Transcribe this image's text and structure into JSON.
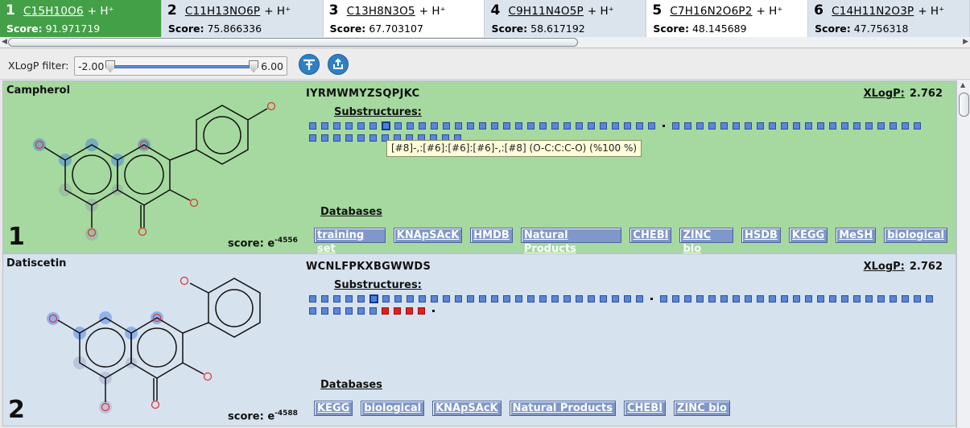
{
  "tabs": [
    {
      "num": "1",
      "formula": "C15H10O6",
      "ion": "+ H⁺",
      "score_label": "Score:",
      "score": "91.971719"
    },
    {
      "num": "2",
      "formula": "C11H13NO6P",
      "ion": "+ H⁺",
      "score_label": "Score:",
      "score": "75.866336"
    },
    {
      "num": "3",
      "formula": "C13H8N3O5",
      "ion": "+ H⁺",
      "score_label": "Score:",
      "score": "67.703107"
    },
    {
      "num": "4",
      "formula": "C9H11N4O5P",
      "ion": "+ H⁺",
      "score_label": "Score:",
      "score": "58.617192"
    },
    {
      "num": "5",
      "formula": "C7H16N2O6P2",
      "ion": "+ H⁺",
      "score_label": "Score:",
      "score": "48.145689"
    },
    {
      "num": "6",
      "formula": "C14H11N2O3P",
      "ion": "+ H⁺",
      "score_label": "Score:",
      "score": "47.756318"
    }
  ],
  "filter": {
    "label": "XLogP filter:",
    "min": "-2.00",
    "max": "6.00"
  },
  "toolbar": {
    "filter_icon": "filter-icon",
    "export_icon": "export-icon"
  },
  "candidates": [
    {
      "name": "Campherol",
      "rank": "1",
      "inchikey": "IYRMWMYZSQPJKC",
      "xlogp_label": "XLogP:",
      "xlogp": "2.762",
      "substructures_label": "Substructures:",
      "databases_label": "Databases",
      "score_prefix": "score: e",
      "score_exp": "-4556",
      "databases": [
        "training set",
        "KNApSAcK",
        "HMDB",
        "Natural Products",
        "CHEBI",
        "ZINC bio",
        "HSDB",
        "KEGG",
        "MeSH",
        "biological"
      ]
    },
    {
      "name": "Datiscetin",
      "rank": "2",
      "inchikey": "WCNLFPKXBGWWDS",
      "xlogp_label": "XLogP:",
      "xlogp": "2.762",
      "substructures_label": "Substructures:",
      "databases_label": "Databases",
      "score_prefix": "score: e",
      "score_exp": "-4588",
      "databases": [
        "KEGG",
        "biological",
        "KNApSAcK",
        "Natural Products",
        "CHEBI",
        "ZINC bio"
      ]
    }
  ],
  "tooltip": "[#8]-,:[#6]:[#6]:[#6]-,:[#8] (O-C:C:C-O)  (%100 %)",
  "colors": {
    "selected_tab": "#43a047",
    "top_candidate": "#a5d99f",
    "other_candidate": "#d6e2ee",
    "fingerprint": "#5a86d8",
    "fingerprint_missing": "#e02020",
    "oxygen": "#e03030"
  }
}
